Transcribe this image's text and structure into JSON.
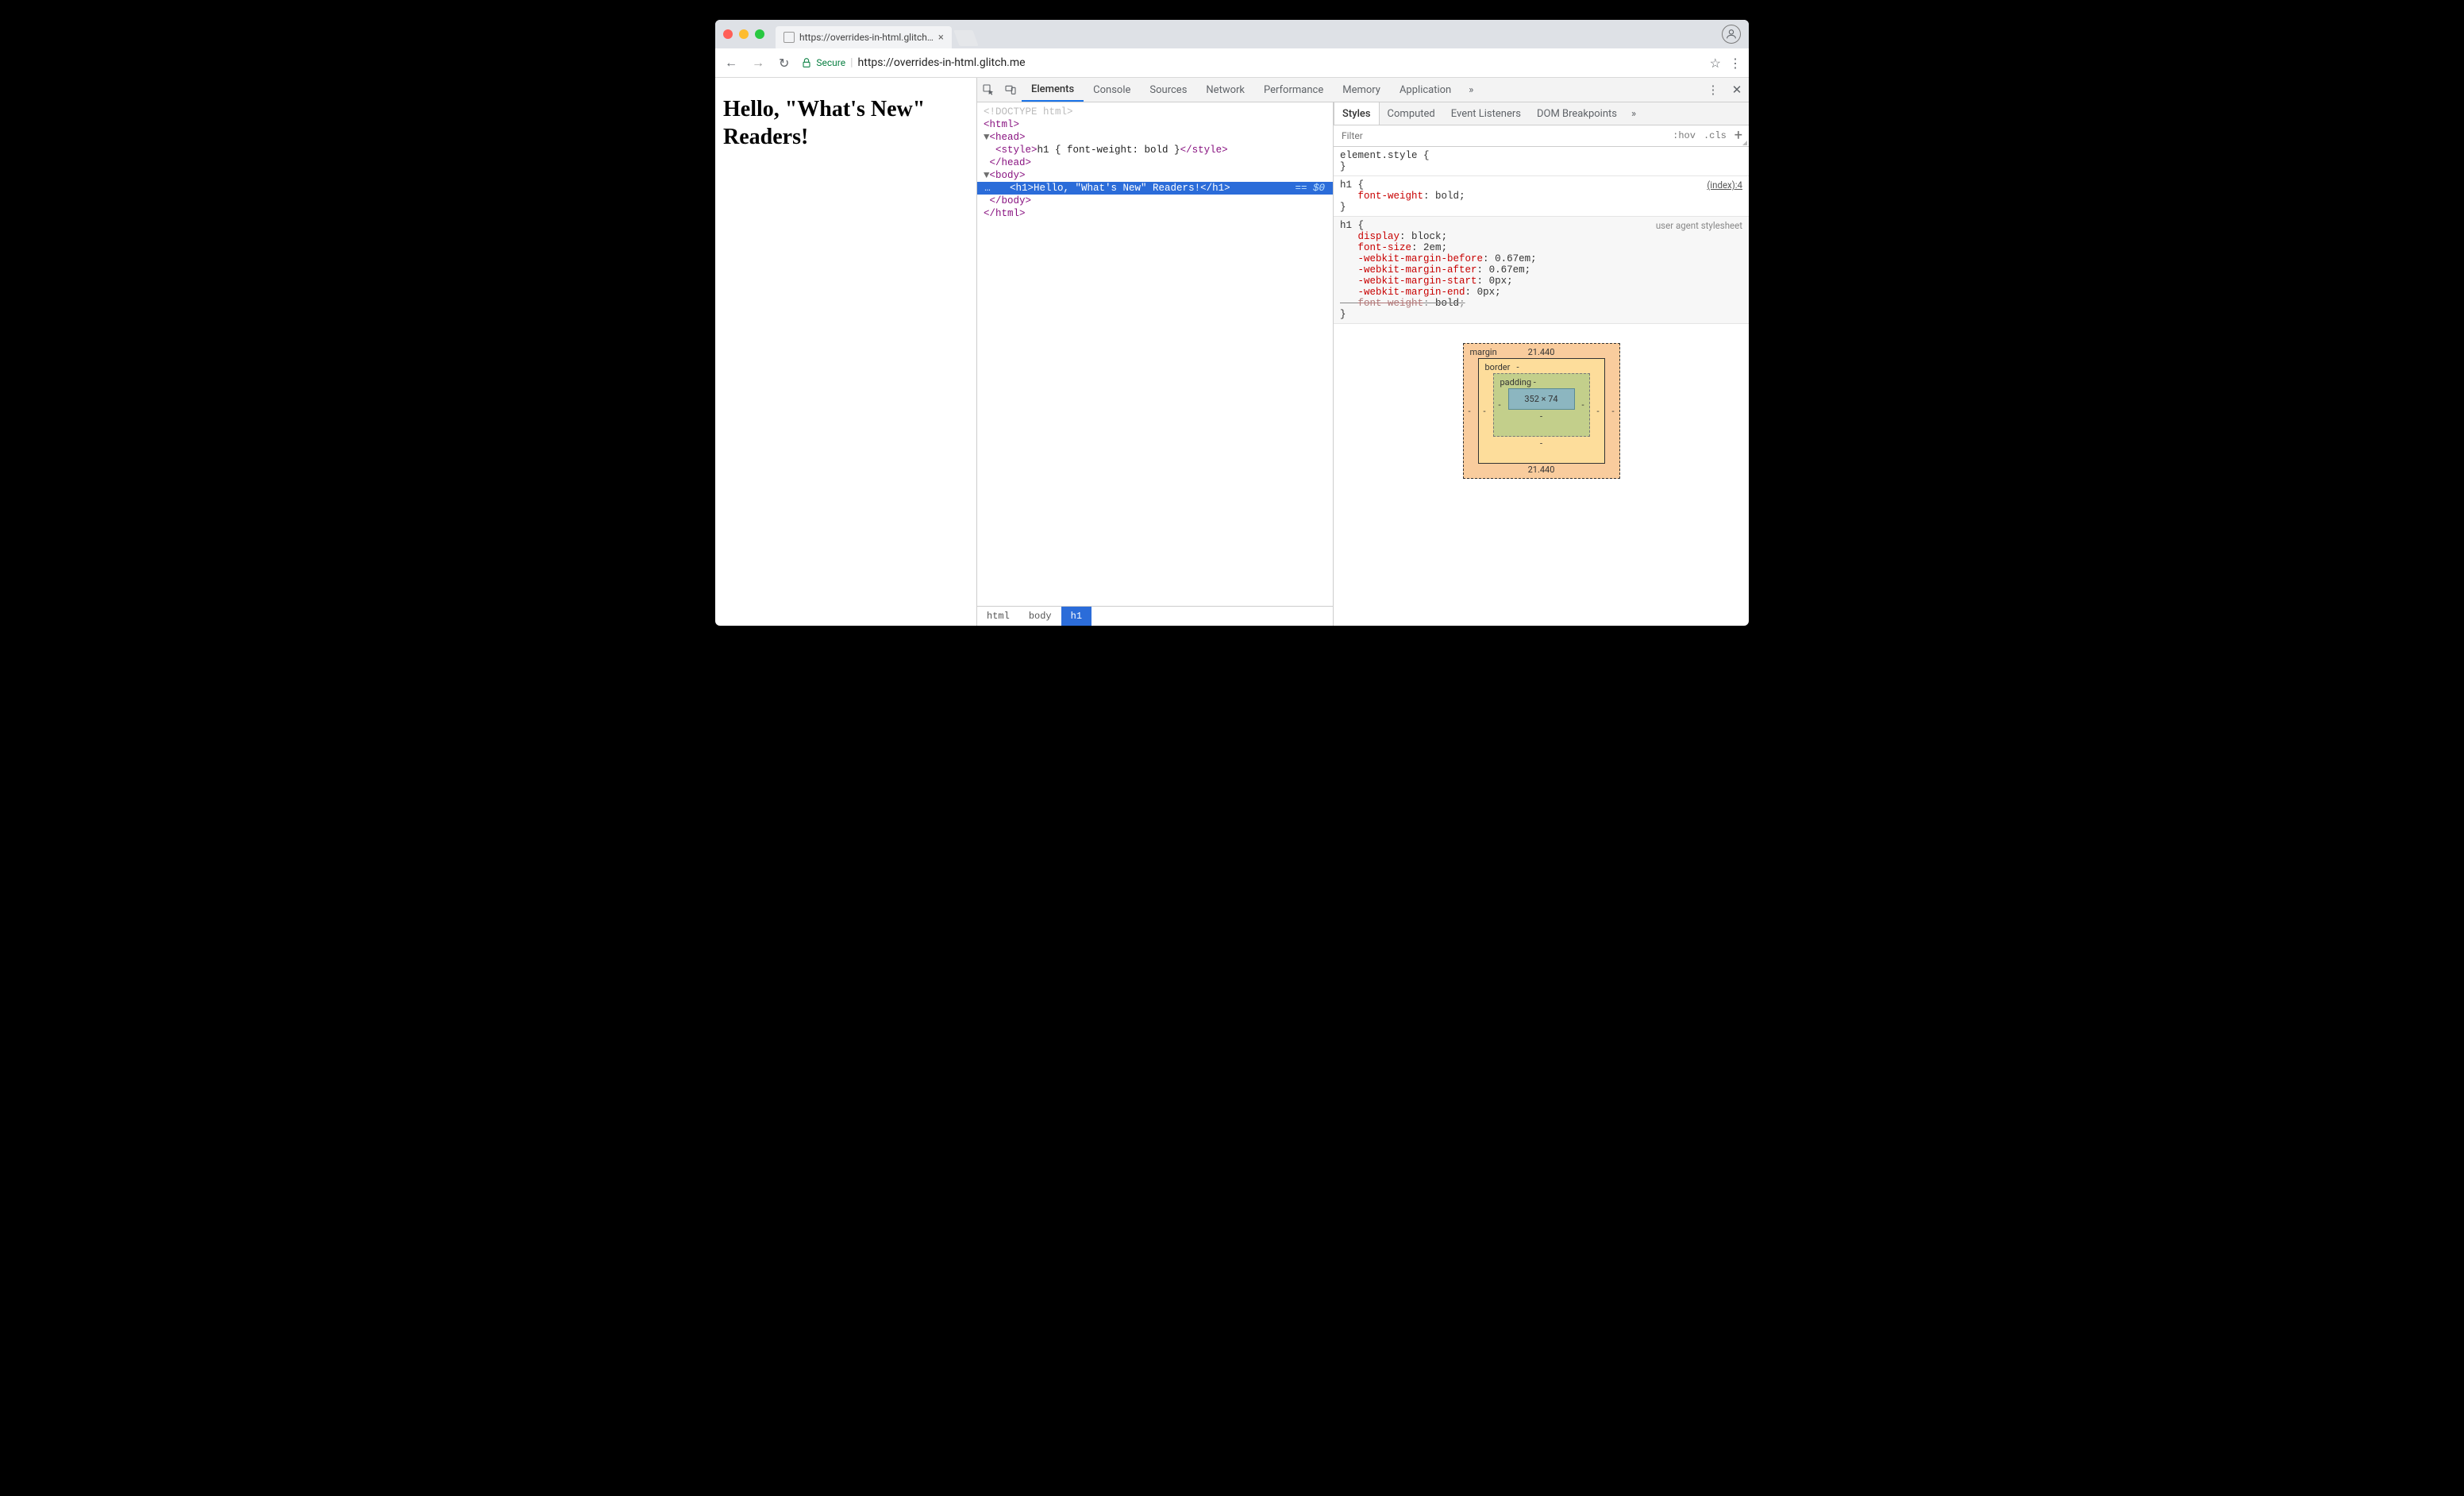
{
  "browser": {
    "tab_title": "https://overrides-in-html.glitch…",
    "secure_label": "Secure",
    "url_display": "https://overrides-in-html.glitch.me",
    "nav": {
      "back": "←",
      "forward": "→",
      "reload": "↻"
    }
  },
  "page": {
    "heading": "Hello, \"What's New\" Readers!"
  },
  "devtools": {
    "tabs": [
      "Elements",
      "Console",
      "Sources",
      "Network",
      "Performance",
      "Memory",
      "Application"
    ],
    "active_tab": "Elements",
    "overflow": "»",
    "dom": {
      "doctype": "<!DOCTYPE html>",
      "open_html": "<html>",
      "open_head": "<head>",
      "style_line_open": "<style>",
      "style_css": "h1 { font-weight: bold }",
      "style_line_close": "</style>",
      "close_head": "</head>",
      "open_body": "<body>",
      "selected_gutter": "…",
      "selected_open": "<h1>",
      "selected_text": "Hello, \"What's New\" Readers!",
      "selected_close": "</h1>",
      "selected_suffix": " == $0",
      "close_body": "</body>",
      "close_html": "</html>"
    },
    "breadcrumbs": [
      "html",
      "body",
      "h1"
    ],
    "breadcrumb_active": "h1",
    "sidebar": {
      "tabs": [
        "Styles",
        "Computed",
        "Event Listeners",
        "DOM Breakpoints"
      ],
      "active_tab": "Styles",
      "overflow": "»",
      "filter_placeholder": "Filter",
      "hov_label": ":hov",
      "cls_label": ".cls",
      "rules": [
        {
          "selector": "element.style",
          "origin": "",
          "origin_link": false,
          "declarations": []
        },
        {
          "selector": "h1",
          "origin": "(index):4",
          "origin_link": true,
          "declarations": [
            {
              "prop": "font-weight",
              "val": "bold",
              "struck": false
            }
          ]
        },
        {
          "selector": "h1",
          "origin": "user agent stylesheet",
          "origin_link": false,
          "inherited": true,
          "declarations": [
            {
              "prop": "display",
              "val": "block",
              "struck": false
            },
            {
              "prop": "font-size",
              "val": "2em",
              "struck": false
            },
            {
              "prop": "-webkit-margin-before",
              "val": "0.67em",
              "struck": false
            },
            {
              "prop": "-webkit-margin-after",
              "val": "0.67em",
              "struck": false
            },
            {
              "prop": "-webkit-margin-start",
              "val": "0px",
              "struck": false
            },
            {
              "prop": "-webkit-margin-end",
              "val": "0px",
              "struck": false
            },
            {
              "prop": "font-weight",
              "val": "bold",
              "struck": true
            }
          ]
        }
      ],
      "boxmodel": {
        "margin_label": "margin",
        "margin_top": "21.440",
        "margin_bottom": "21.440",
        "margin_side": "-",
        "border_label": "border",
        "border_val": "-",
        "padding_label": "padding",
        "padding_val": "-",
        "content": "352 × 74"
      }
    }
  }
}
